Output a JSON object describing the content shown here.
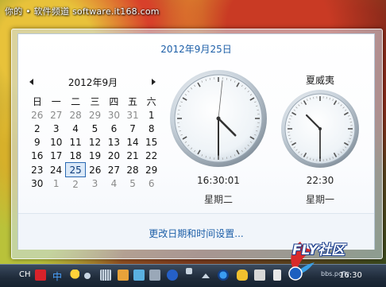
{
  "watermark": "你的 • 软件频道 software.it168.com",
  "panel": {
    "top_date": "2012年9月25日",
    "footer_link": "更改日期和时间设置..."
  },
  "calendar": {
    "month_title": "2012年9月",
    "weekdays": [
      "日",
      "一",
      "二",
      "三",
      "四",
      "五",
      "六"
    ],
    "weeks": [
      [
        "26",
        "27",
        "28",
        "29",
        "30",
        "31",
        "1"
      ],
      [
        "2",
        "3",
        "4",
        "5",
        "6",
        "7",
        "8"
      ],
      [
        "9",
        "10",
        "11",
        "12",
        "13",
        "14",
        "15"
      ],
      [
        "16",
        "17",
        "18",
        "19",
        "20",
        "21",
        "22"
      ],
      [
        "23",
        "24",
        "25",
        "26",
        "27",
        "28",
        "29"
      ],
      [
        "30",
        "1",
        "2",
        "3",
        "4",
        "5",
        "6"
      ]
    ],
    "selected_day": "25"
  },
  "clocks": [
    {
      "label": "",
      "time": "16:30:01",
      "day": "星期二",
      "hour": 16,
      "minute": 30,
      "second": 1
    },
    {
      "label": "夏威夷",
      "time": "22:30",
      "day": "星期一",
      "hour": 22,
      "minute": 30,
      "second": null
    }
  ],
  "taskbar": {
    "lang": "CH",
    "ime": "中",
    "clock": "16:30"
  },
  "logo": {
    "text": "FLY社区",
    "sub": "bbs.pcfly"
  },
  "colors": {
    "accent": "#1d5fa8",
    "selected_bg": "#dbe9f8",
    "taskbar": "#1f2b3a"
  }
}
